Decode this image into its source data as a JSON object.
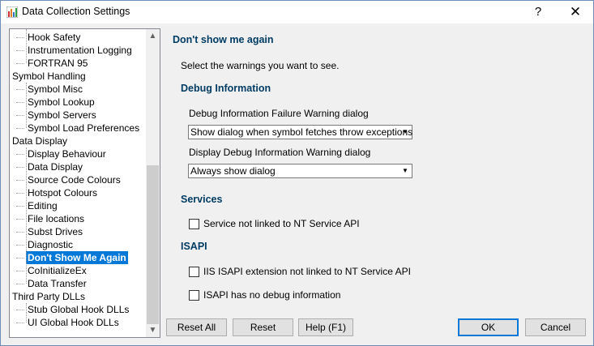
{
  "window": {
    "title": "Data Collection Settings",
    "help_glyph": "?",
    "close_glyph": "✕"
  },
  "tree": {
    "items": [
      {
        "label": "Hook Safety",
        "level": 1
      },
      {
        "label": "Instrumentation Logging",
        "level": 1
      },
      {
        "label": "FORTRAN 95",
        "level": 1
      },
      {
        "label": "Symbol Handling",
        "level": 0
      },
      {
        "label": "Symbol Misc",
        "level": 1
      },
      {
        "label": "Symbol Lookup",
        "level": 1
      },
      {
        "label": "Symbol Servers",
        "level": 1
      },
      {
        "label": "Symbol Load Preferences",
        "level": 1
      },
      {
        "label": "Data Display",
        "level": 0
      },
      {
        "label": "Display Behaviour",
        "level": 1
      },
      {
        "label": "Data Display",
        "level": 1
      },
      {
        "label": "Source Code Colours",
        "level": 1
      },
      {
        "label": "Hotspot Colours",
        "level": 1
      },
      {
        "label": "Editing",
        "level": 1
      },
      {
        "label": "File locations",
        "level": 1
      },
      {
        "label": "Subst Drives",
        "level": 1
      },
      {
        "label": "Diagnostic",
        "level": 1
      },
      {
        "label": "Don't Show Me Again",
        "level": 1,
        "selected": true
      },
      {
        "label": "CoInitializeEx",
        "level": 1
      },
      {
        "label": "Data Transfer",
        "level": 1
      },
      {
        "label": "Third Party DLLs",
        "level": 0
      },
      {
        "label": "Stub Global Hook DLLs",
        "level": 1
      },
      {
        "label": "UI Global Hook DLLs",
        "level": 1
      }
    ]
  },
  "panel": {
    "title": "Don't show me again",
    "intro": "Select the warnings you want to see.",
    "debug": {
      "heading": "Debug Information",
      "failure_label": "Debug Information Failure Warning dialog",
      "failure_value": "Show dialog when symbol fetches throw exceptions",
      "display_label": "Display Debug Information Warning dialog",
      "display_value": "Always show dialog"
    },
    "services": {
      "heading": "Services",
      "cb1": "Service not linked to NT Service API"
    },
    "isapi": {
      "heading": "ISAPI",
      "cb1": "IIS ISAPI extension not linked to NT Service API",
      "cb2": "ISAPI has no debug information"
    }
  },
  "buttons": {
    "reset_all": "Reset All",
    "reset": "Reset",
    "help": "Help (F1)",
    "ok": "OK",
    "cancel": "Cancel"
  }
}
